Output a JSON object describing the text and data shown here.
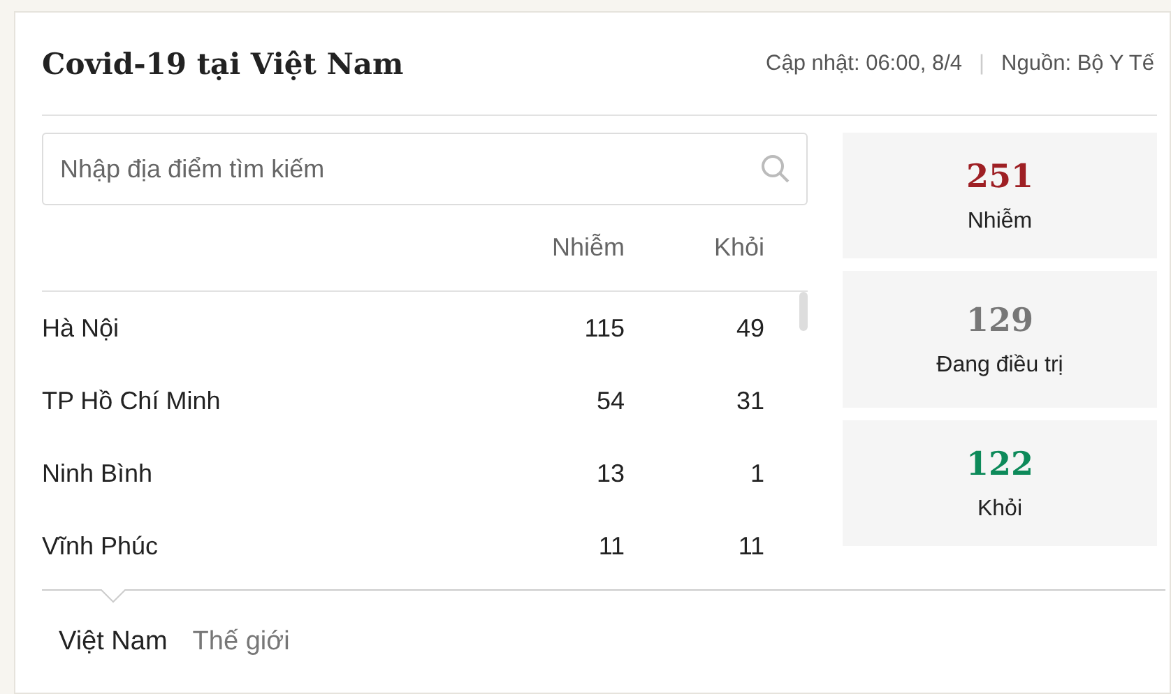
{
  "header": {
    "title": "Covid-19 tại Việt Nam",
    "updated": "Cập nhật: 06:00, 8/4",
    "separator": "|",
    "source": "Nguồn: Bộ Y Tế"
  },
  "search": {
    "placeholder": "Nhập địa điểm tìm kiếm"
  },
  "table": {
    "columns": [
      "Nhiễm",
      "Khỏi"
    ],
    "rows": [
      {
        "place": "Hà Nội",
        "infected": "115",
        "recovered": "49"
      },
      {
        "place": "TP Hồ Chí Minh",
        "infected": "54",
        "recovered": "31"
      },
      {
        "place": "Ninh Bình",
        "infected": "13",
        "recovered": "1"
      },
      {
        "place": "Vĩnh Phúc",
        "infected": "11",
        "recovered": "11"
      }
    ]
  },
  "stats": [
    {
      "value": "251",
      "label": "Nhiễm",
      "color": "#9e1f24"
    },
    {
      "value": "129",
      "label": "Đang điều trị",
      "color": "#777777"
    },
    {
      "value": "122",
      "label": "Khỏi",
      "color": "#0d8a5a"
    }
  ],
  "tabs": [
    {
      "label": "Việt Nam",
      "selected": true
    },
    {
      "label": "Thế giới",
      "selected": false
    }
  ]
}
